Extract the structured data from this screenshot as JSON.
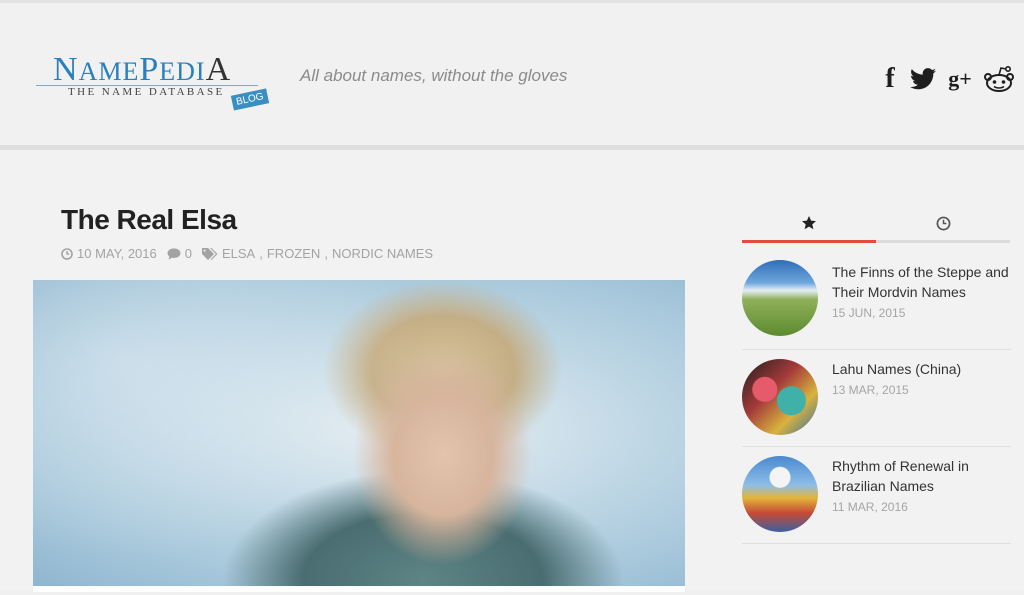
{
  "header": {
    "logo": {
      "title_initial": "N",
      "title_rest_1": "AME",
      "title_mid_initial": "P",
      "title_rest_2": "EDI",
      "title_end": "A",
      "subtitle": "THE NAME DATABASE",
      "badge": "BLOG"
    },
    "tagline": "All about names, without the gloves",
    "social": [
      {
        "name": "facebook",
        "glyph": "f"
      },
      {
        "name": "twitter",
        "icon": "twitter-bird-icon"
      },
      {
        "name": "google-plus",
        "glyph": "g+"
      },
      {
        "name": "reddit",
        "icon": "reddit-alien-icon"
      }
    ]
  },
  "post": {
    "title": "The Real Elsa",
    "date": "10 MAY, 2016",
    "comments": "0",
    "tags": [
      "ELSA",
      "FROZEN",
      "NORDIC NAMES"
    ],
    "tag_sep": ","
  },
  "sidebar": {
    "tabs": [
      {
        "name": "popular",
        "icon": "star-icon",
        "active": true,
        "accent": "#e24d3b"
      },
      {
        "name": "recent",
        "icon": "clock-icon",
        "active": false
      }
    ],
    "items": [
      {
        "title": "The Finns of the Steppe and Their Mordvin Names",
        "date": "15 JUN, 2015"
      },
      {
        "title": "Lahu Names (China)",
        "date": "13 MAR, 2015"
      },
      {
        "title": "Rhythm of Renewal in Brazilian Names",
        "date": "11 MAR, 2016"
      }
    ]
  }
}
